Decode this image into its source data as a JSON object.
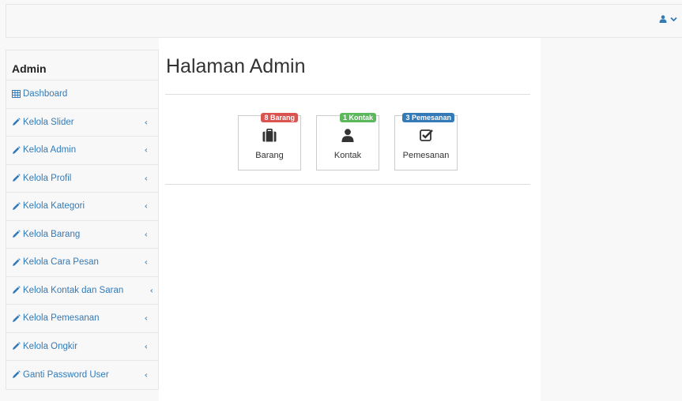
{
  "topbar": {
    "user_icon": "user-icon",
    "caret_icon": "chevron-down-icon"
  },
  "sidebar": {
    "title": "Admin",
    "items": [
      {
        "label": "Dashboard",
        "icon": "table-icon",
        "has_chevron": false
      },
      {
        "label": "Kelola Slider",
        "icon": "pencil-icon",
        "has_chevron": true
      },
      {
        "label": "Kelola Admin",
        "icon": "pencil-icon",
        "has_chevron": true
      },
      {
        "label": "Kelola Profil",
        "icon": "pencil-icon",
        "has_chevron": true
      },
      {
        "label": "Kelola Kategori",
        "icon": "pencil-icon",
        "has_chevron": true
      },
      {
        "label": "Kelola Barang",
        "icon": "pencil-icon",
        "has_chevron": true
      },
      {
        "label": "Kelola Cara Pesan",
        "icon": "pencil-icon",
        "has_chevron": true
      },
      {
        "label": "Kelola Kontak dan Saran",
        "icon": "pencil-icon",
        "has_chevron": true
      },
      {
        "label": "Kelola Pemesanan",
        "icon": "pencil-icon",
        "has_chevron": true
      },
      {
        "label": "Kelola Ongkir",
        "icon": "pencil-icon",
        "has_chevron": true
      },
      {
        "label": "Ganti Password User",
        "icon": "pencil-icon",
        "has_chevron": true
      }
    ],
    "chevron": "‹"
  },
  "main": {
    "title": "Halaman Admin",
    "tiles": [
      {
        "label": "Barang",
        "badge": "8 Barang",
        "badge_color": "#d9534f",
        "icon": "briefcase-icon"
      },
      {
        "label": "Kontak",
        "badge": "1 Kontak",
        "badge_color": "#5cb85c",
        "icon": "user-icon"
      },
      {
        "label": "Pemesanan",
        "badge": "3 Pemesanan",
        "badge_color": "#337ab7",
        "icon": "check-square-icon"
      }
    ]
  },
  "colors": {
    "link": "#337ab7",
    "border": "#e7e7e7"
  }
}
